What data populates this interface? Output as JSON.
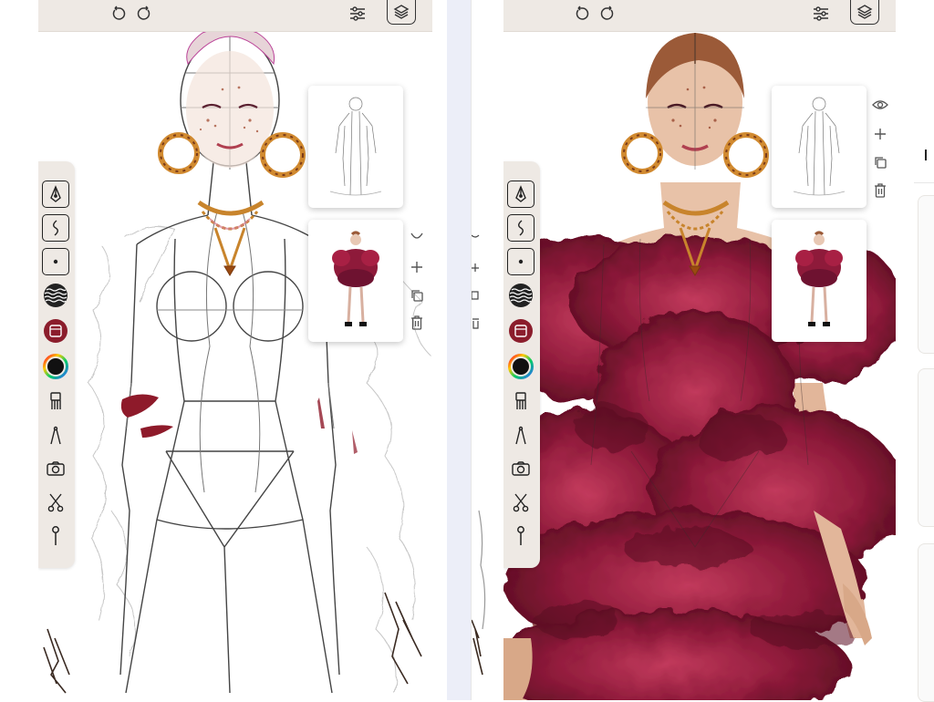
{
  "colors": {
    "toolbar_bg": "#eee9e4",
    "ruffle_primary": "#8e1a3a",
    "ruffle_dark": "#5a0d22",
    "ruffle_light": "#c23a5c",
    "swatch_fill": "#8b1d2c",
    "skin": "#e8c8b4",
    "hair": "#9b5a38",
    "gold": "#c8842c"
  },
  "panels": [
    {
      "id": "left",
      "state": "sketch",
      "topbar": {
        "icons": [
          "undo-icon",
          "redo-icon",
          "adjustments-icon",
          "layers-icon"
        ]
      },
      "toolbar": {
        "tools": [
          "pen-nib-icon",
          "curve-line-icon",
          "dot-brush-icon",
          "texture-pattern-icon",
          "color-swatch",
          "color-wheel",
          "comb-brush-icon",
          "compass-icon",
          "camera-icon",
          "scissors-icon",
          "pin-icon"
        ]
      },
      "layers": [
        {
          "name": "line-sketch-layer",
          "selected": false
        },
        {
          "name": "red-dress-reference-layer",
          "selected": false
        }
      ],
      "layer_actions": [
        "add-icon",
        "duplicate-icon",
        "trash-icon"
      ]
    },
    {
      "id": "right",
      "state": "painted",
      "topbar": {
        "icons": [
          "undo-icon",
          "redo-icon",
          "adjustments-icon",
          "layers-icon"
        ]
      },
      "toolbar": {
        "tools": [
          "pen-nib-icon",
          "curve-line-icon",
          "dot-brush-icon",
          "texture-pattern-icon",
          "color-swatch",
          "color-wheel",
          "comb-brush-icon",
          "compass-icon",
          "camera-icon",
          "scissors-icon",
          "pin-icon"
        ]
      },
      "layers": [
        {
          "name": "line-sketch-layer",
          "selected": false
        },
        {
          "name": "red-dress-reference-layer",
          "selected": false
        }
      ],
      "layer_actions": [
        "eye-icon",
        "add-icon",
        "duplicate-icon",
        "trash-icon"
      ]
    }
  ]
}
